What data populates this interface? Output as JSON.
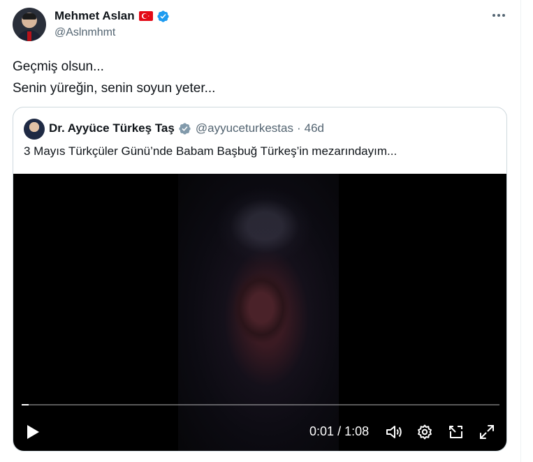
{
  "author": {
    "name": "Mehmet Aslan",
    "handle": "@Aslnmhmt",
    "flag": "turkey-flag",
    "verified_color": "#1d9bf0"
  },
  "tweet": {
    "lines": [
      "Geçmiş olsun...",
      "Senin yüreğin, senin soyun yeter..."
    ]
  },
  "quoted": {
    "name": "Dr. Ayyüce Türkeş Taş",
    "handle": "@ayyuceturkestas",
    "separator": "·",
    "time": "46d",
    "badge_color": "#829aab",
    "text": "3 Mayıs Türkçüler Günü’nde Babam Başbuğ Türkeş’in mezarındayım..."
  },
  "video": {
    "current_time": "0:01",
    "separator": "/",
    "duration": "1:08",
    "progress_fraction": 0.015
  },
  "icons": {
    "more": "more-horizontal-icon",
    "play": "play-icon",
    "volume": "volume-icon",
    "settings": "settings-gear-icon",
    "pip": "picture-in-picture-icon",
    "fullscreen": "fullscreen-icon"
  }
}
